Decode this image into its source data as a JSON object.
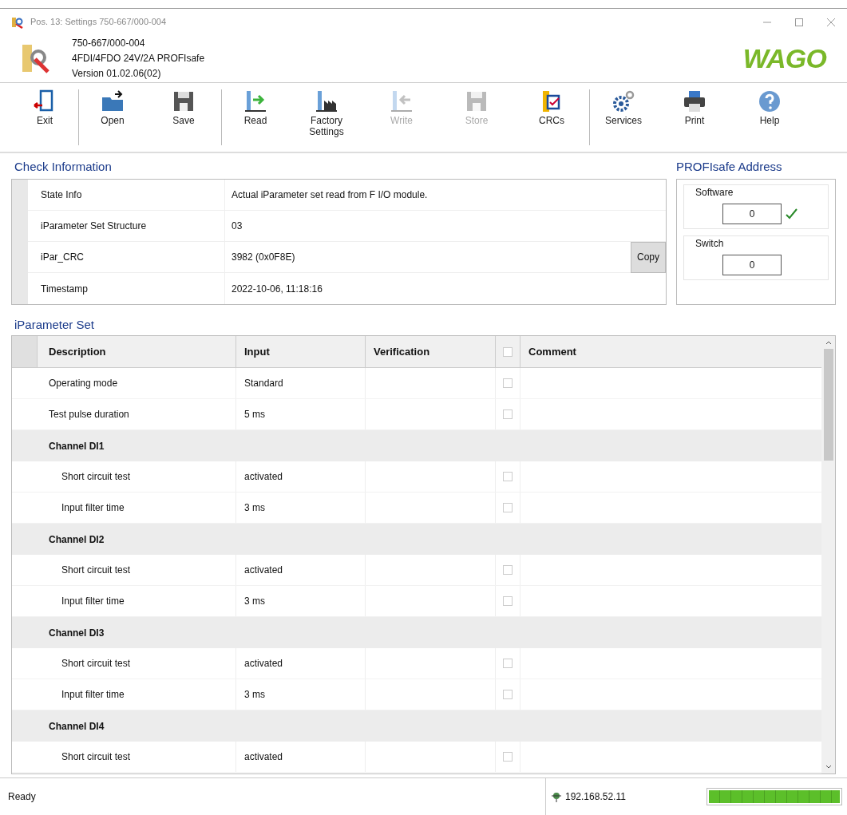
{
  "window": {
    "title": "Pos. 13: Settings 750-667/000-004"
  },
  "header": {
    "lines": [
      "750-667/000-004",
      "4FDI/4FDO 24V/2A PROFIsafe",
      "Version 01.02.06(02)"
    ],
    "logo": "WAGO"
  },
  "toolbar": [
    [
      {
        "kind": "exit",
        "label": "Exit",
        "disabled": false
      }
    ],
    [
      {
        "kind": "open",
        "label": "Open",
        "disabled": false
      },
      {
        "kind": "save",
        "label": "Save",
        "disabled": false
      }
    ],
    [
      {
        "kind": "read",
        "label": "Read",
        "disabled": false
      },
      {
        "kind": "factory",
        "label": "Factory Settings",
        "disabled": false
      },
      {
        "kind": "write",
        "label": "Write",
        "disabled": true
      },
      {
        "kind": "store",
        "label": "Store",
        "disabled": true
      },
      {
        "kind": "crcs",
        "label": "CRCs",
        "disabled": false
      }
    ],
    [
      {
        "kind": "services",
        "label": "Services",
        "disabled": false
      },
      {
        "kind": "print",
        "label": "Print",
        "disabled": false
      },
      {
        "kind": "help",
        "label": "Help",
        "disabled": false
      }
    ]
  ],
  "check_information": {
    "title": "Check Information",
    "rows": [
      {
        "label": "State Info",
        "value": "Actual iParameter set read from F I/O module."
      },
      {
        "label": "iParameter Set Structure",
        "value": "03"
      },
      {
        "label": "iPar_CRC",
        "value": "3982 (0x0F8E)",
        "button": "Copy"
      },
      {
        "label": "Timestamp",
        "value": "2022-10-06, 11:18:16"
      }
    ]
  },
  "profisafe_address": {
    "title": "PROFIsafe Address",
    "fields": [
      {
        "label": "Software",
        "value": "0",
        "valid": true
      },
      {
        "label": "Switch",
        "value": "0",
        "valid": false
      }
    ]
  },
  "iparameter_set": {
    "title": "iParameter Set",
    "columns": [
      "Description",
      "Input",
      "Verification",
      "Comment"
    ],
    "header_checked": false,
    "rows": [
      {
        "kind": "param",
        "description": "Operating mode",
        "input": "Standard",
        "checked": false
      },
      {
        "kind": "param",
        "description": "Test pulse duration",
        "input": "5 ms",
        "checked": false
      },
      {
        "kind": "group",
        "description": "Channel DI1",
        "children": [
          {
            "kind": "param",
            "description": "Short circuit test",
            "input": "activated",
            "checked": false
          },
          {
            "kind": "param",
            "description": "Input filter time",
            "input": "3 ms",
            "checked": false
          }
        ]
      },
      {
        "kind": "group",
        "description": "Channel DI2",
        "children": [
          {
            "kind": "param",
            "description": "Short circuit test",
            "input": "activated",
            "checked": false
          },
          {
            "kind": "param",
            "description": "Input filter time",
            "input": "3 ms",
            "checked": false
          }
        ]
      },
      {
        "kind": "group",
        "description": "Channel DI3",
        "children": [
          {
            "kind": "param",
            "description": "Short circuit test",
            "input": "activated",
            "checked": false
          },
          {
            "kind": "param",
            "description": "Input filter time",
            "input": "3 ms",
            "checked": false
          }
        ]
      },
      {
        "kind": "group",
        "description": "Channel DI4",
        "children": [
          {
            "kind": "param",
            "description": "Short circuit test",
            "input": "activated",
            "checked": false
          }
        ]
      }
    ]
  },
  "status_bar": {
    "status": "Ready",
    "ip": "192.168.52.11",
    "connection": {
      "level": 1
    }
  }
}
